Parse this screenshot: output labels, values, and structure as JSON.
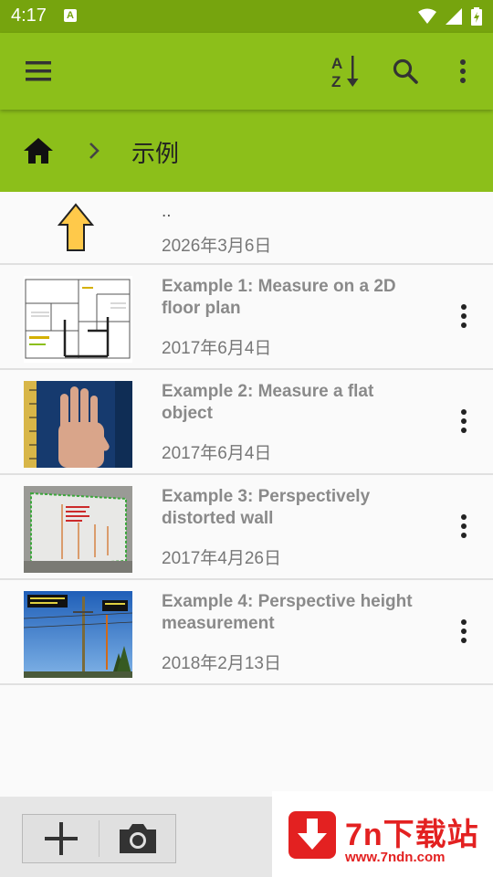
{
  "status_bar": {
    "time": "4:17",
    "notification_letter": "A"
  },
  "toolbar": {
    "menu_icon": "hamburger-icon",
    "sort_icon": "sort-az-icon",
    "search_icon": "search-icon",
    "overflow_icon": "more-vert-icon"
  },
  "breadcrumb": {
    "home_icon": "home-icon",
    "current": "示例"
  },
  "colors": {
    "toolbar": "#8cbf1a",
    "statusbar": "#76a40e",
    "parent_arrow": "#ffc94a"
  },
  "files": {
    "parent": {
      "name": "..",
      "date": "2026年3月6日"
    },
    "items": [
      {
        "title": "Example 1: Measure on a 2D floor plan",
        "date": "2017年6月4日"
      },
      {
        "title": "Example 2: Measure a flat object",
        "date": "2017年6月4日"
      },
      {
        "title": "Example 3: Perspectively distorted wall",
        "date": "2017年4月26日"
      },
      {
        "title": "Example 4: Perspective height measurement",
        "date": "2018年2月13日"
      }
    ]
  },
  "bottom_bar": {
    "add_icon": "plus-icon",
    "camera_icon": "camera-icon"
  },
  "watermark": {
    "title": "7n下载站",
    "url": "www.7ndn.com"
  }
}
